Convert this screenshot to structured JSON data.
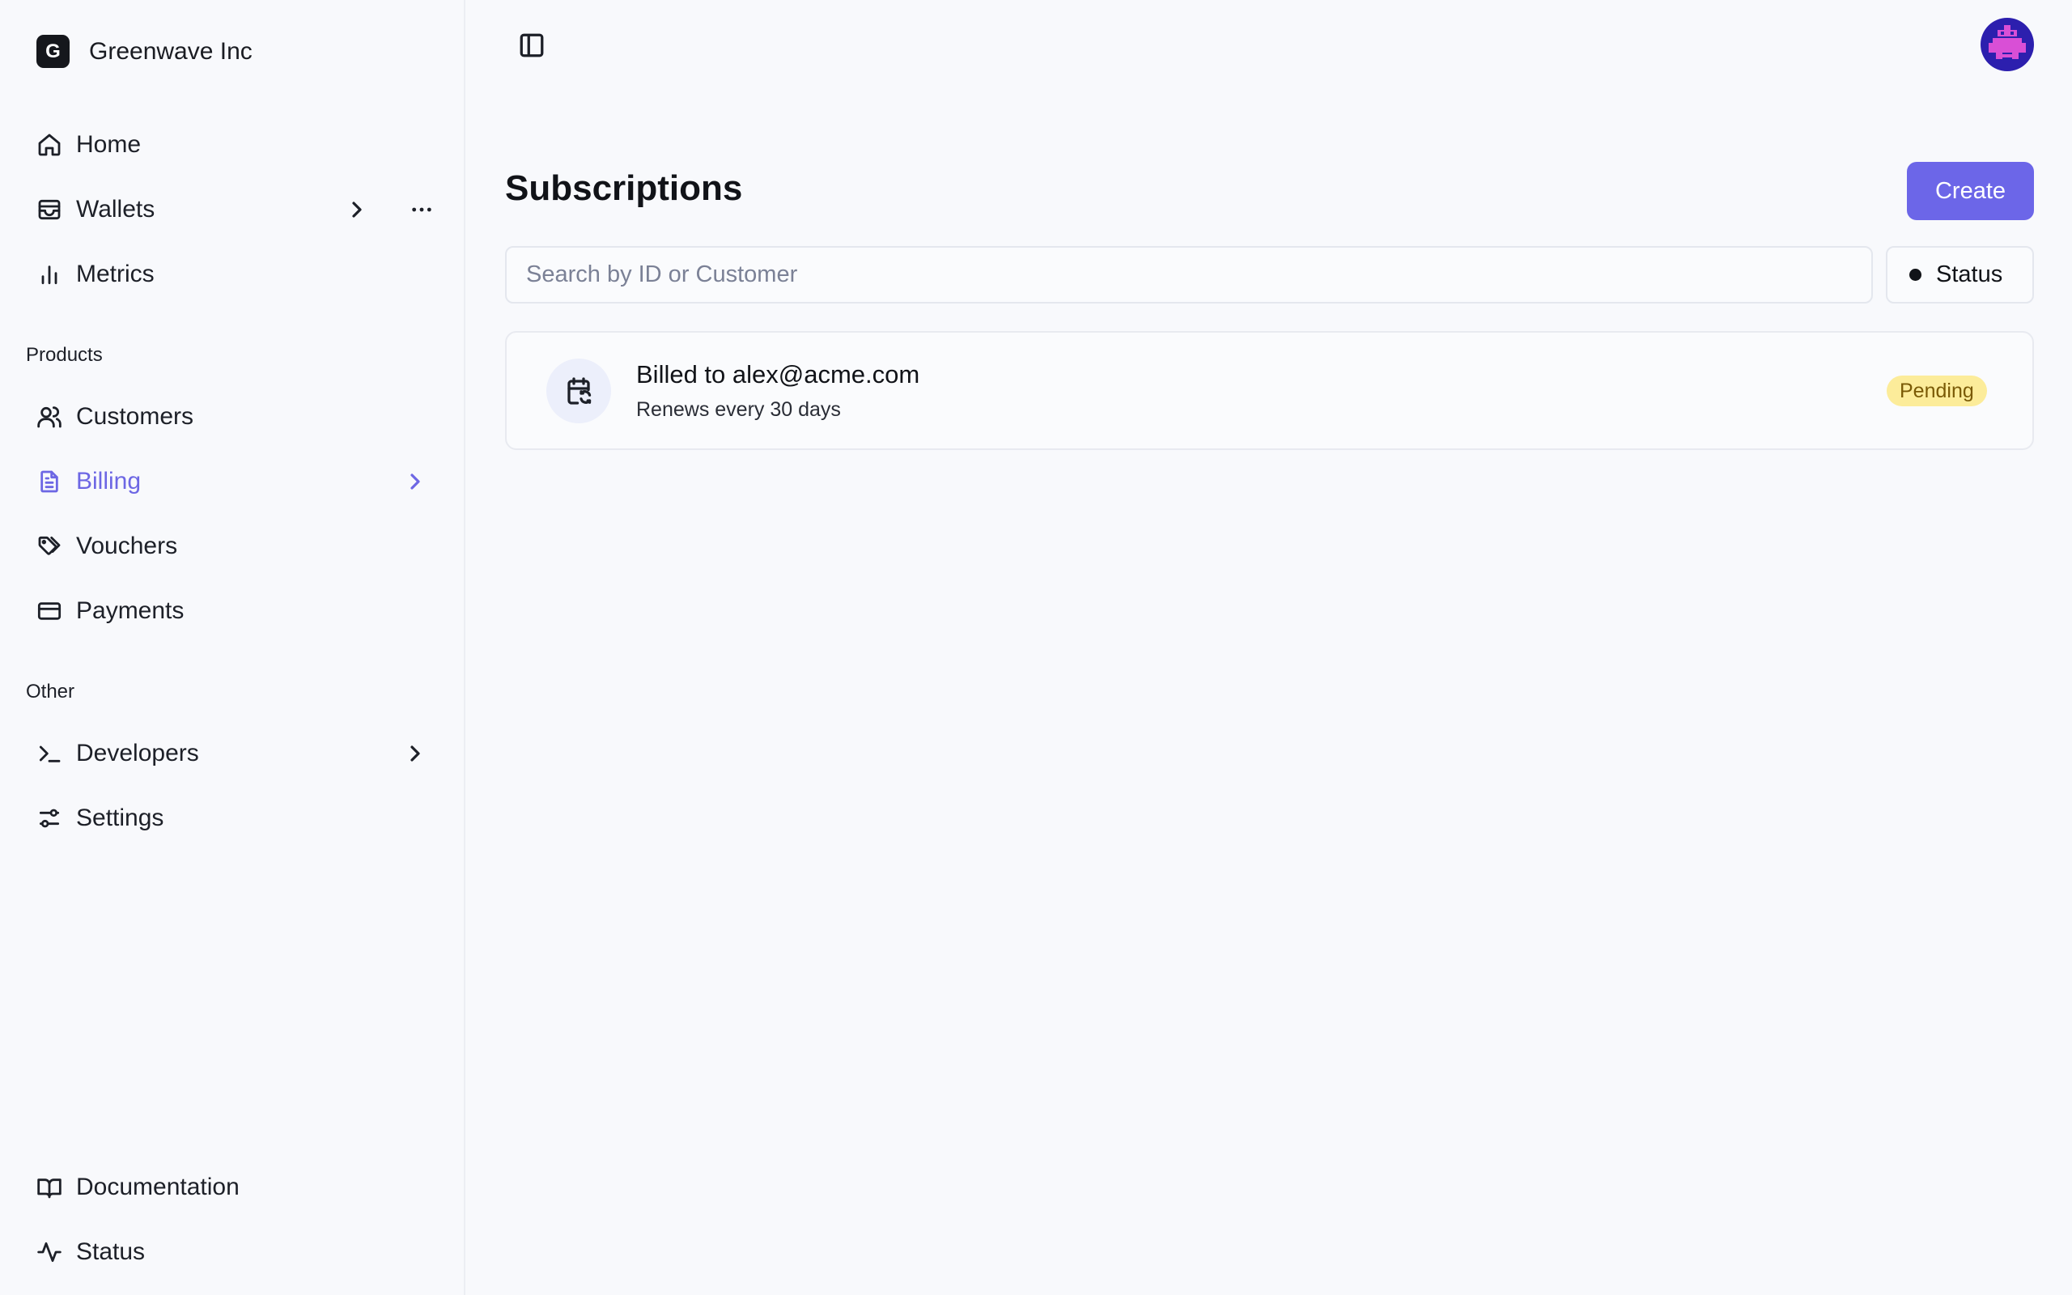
{
  "org": {
    "logo_letter": "G",
    "name": "Greenwave Inc"
  },
  "sidebar": {
    "main_items": [
      {
        "label": "Home",
        "icon": "home-icon"
      },
      {
        "label": "Wallets",
        "icon": "wallet-icon"
      },
      {
        "label": "Metrics",
        "icon": "bar-chart-icon"
      }
    ],
    "products_label": "Products",
    "product_items": [
      {
        "label": "Customers",
        "icon": "users-icon"
      },
      {
        "label": "Billing",
        "icon": "document-icon",
        "active": true
      },
      {
        "label": "Vouchers",
        "icon": "tags-icon"
      },
      {
        "label": "Payments",
        "icon": "credit-card-icon"
      }
    ],
    "other_label": "Other",
    "other_items": [
      {
        "label": "Developers",
        "icon": "terminal-icon"
      },
      {
        "label": "Settings",
        "icon": "sliders-icon"
      }
    ],
    "footer_items": [
      {
        "label": "Documentation",
        "icon": "book-icon"
      },
      {
        "label": "Status",
        "icon": "activity-icon"
      }
    ]
  },
  "main": {
    "title": "Subscriptions",
    "create_label": "Create",
    "search": {
      "placeholder": "Search by ID or Customer",
      "value": ""
    },
    "status_filter_label": "Status",
    "subscriptions": [
      {
        "title": "Billed to alex@acme.com",
        "description": "Renews every 30 days",
        "status": "Pending",
        "icon": "calendar-refresh-icon"
      }
    ]
  },
  "colors": {
    "accent": "#6c66e8",
    "active_nav": "#6d67e4",
    "pending_badge_bg": "#fcec9a",
    "pending_badge_text": "#7a5a06"
  }
}
